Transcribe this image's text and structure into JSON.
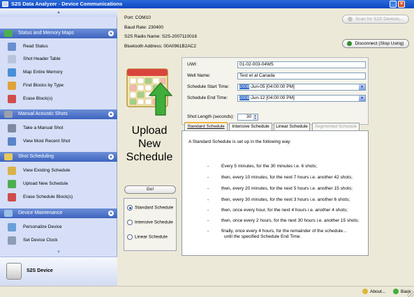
{
  "window": {
    "title": "S2S Data Analyzer - Device Communications"
  },
  "sidebar": {
    "sections": [
      {
        "title": "Status and Memory Maps",
        "items": [
          "Read Status",
          "Shot Header Table",
          "Map Entire Memory",
          "Find Blocks by Type",
          "Erase Block(s)"
        ]
      },
      {
        "title": "Manual Acoustic Shots",
        "items": [
          "Take a Manual Shot",
          "View Most Recent Shot"
        ]
      },
      {
        "title": "Shot Scheduling",
        "items": [
          "View Existing Schedule",
          "Upload New Schedule",
          "Erase Schedule Block(s)"
        ]
      },
      {
        "title": "Device Maintenance",
        "items": [
          "Personalize Device",
          "Set Device Clock"
        ]
      }
    ],
    "footer_label": "S2S Device"
  },
  "device": {
    "port": "Port: COM10",
    "baud": "Baud Rate: 230400",
    "radio_name": "S2S Radio Name: S2S-2007110016",
    "bt_address": "Bluetooth Address: 00A0961B2AC2"
  },
  "buttons": {
    "scan": "Scan for S2S Devices...",
    "disconnect": "Disconnect (Stop Using)",
    "go": "Go!"
  },
  "upload_heading": "Upload New Schedule",
  "schedule_type_options": [
    "Standard Schedule",
    "Intensive Schedule",
    "Linear Schedule"
  ],
  "selected_schedule_type": "Standard Schedule",
  "form": {
    "uwi_label": "UWI:",
    "uwi_value": "01-02-003-04W5",
    "well_name_label": "Well Name:",
    "well_name_value": "Test et al Canada",
    "start_label": "Schedule Start Time:",
    "start_year": "2008",
    "start_rest": "-Jun-05   [04:00:00 PM]",
    "end_label": "Schedule End Time:",
    "end_year": "2008",
    "end_rest": "-Jun-12   [04:00:00 PM]",
    "shot_length_label": "Shot Length (seconds):",
    "shot_length_value": "30"
  },
  "tabs": [
    "Standard Schedule",
    "Intensive Schedule",
    "Linear Schedule",
    "Segmented Schedule"
  ],
  "schedule_description": {
    "intro": "A Standard Schedule is set up in the following way:",
    "bullet": "-",
    "lines": [
      "Every 5 minutes, for the 30 minutes i.e. 6 shots;",
      "then, every 10 minutes, for the next 7 hours i.e. another 42 shots;",
      "then, every 20 minutes, for the next 5 hours i.e. another 15 shots;",
      "then, every 30 minutes, for the next 3 hours i.e. another 6 shots;",
      "then, once every hour, for the next 4 hours i.e. another 4 shots;",
      "then, once every 2 hours, for the next 30 hours i.e. another 15 shots;",
      "finally, once every 4 hours, for the remainder of the schedule...",
      "until the specified Schedule End Time."
    ]
  },
  "statusbar": {
    "about": "About...",
    "back": "Back"
  },
  "colors": {
    "title_blue": "#0b46c4",
    "section_blue": "#3d64c0",
    "active_tab_accent": "#f0b43a",
    "selection": "#316ac5"
  }
}
